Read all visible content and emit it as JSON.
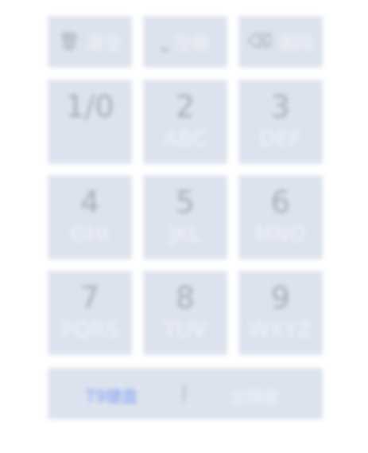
{
  "function_row": {
    "clear": {
      "icon": "trash-icon",
      "glyph": "🗑",
      "label": "清空"
    },
    "space": {
      "icon": "space-bar-icon",
      "glyph": "⎵",
      "label": "空格"
    },
    "delete": {
      "icon": "backspace-icon",
      "glyph": "⌫",
      "label": "删除"
    }
  },
  "keys": [
    {
      "digit": "1/0",
      "letters": ""
    },
    {
      "digit": "2",
      "letters": "ABC"
    },
    {
      "digit": "3",
      "letters": "DEF"
    },
    {
      "digit": "4",
      "letters": "GHI"
    },
    {
      "digit": "5",
      "letters": "JKL"
    },
    {
      "digit": "6",
      "letters": "MNO"
    },
    {
      "digit": "7",
      "letters": "PQRS"
    },
    {
      "digit": "8",
      "letters": "TUV"
    },
    {
      "digit": "9",
      "letters": "WXYZ"
    }
  ],
  "mode_bar": {
    "t9_label": "T9键盘",
    "separator": "|",
    "full_label": "全键盘",
    "active_color": "#7f9ff0"
  }
}
